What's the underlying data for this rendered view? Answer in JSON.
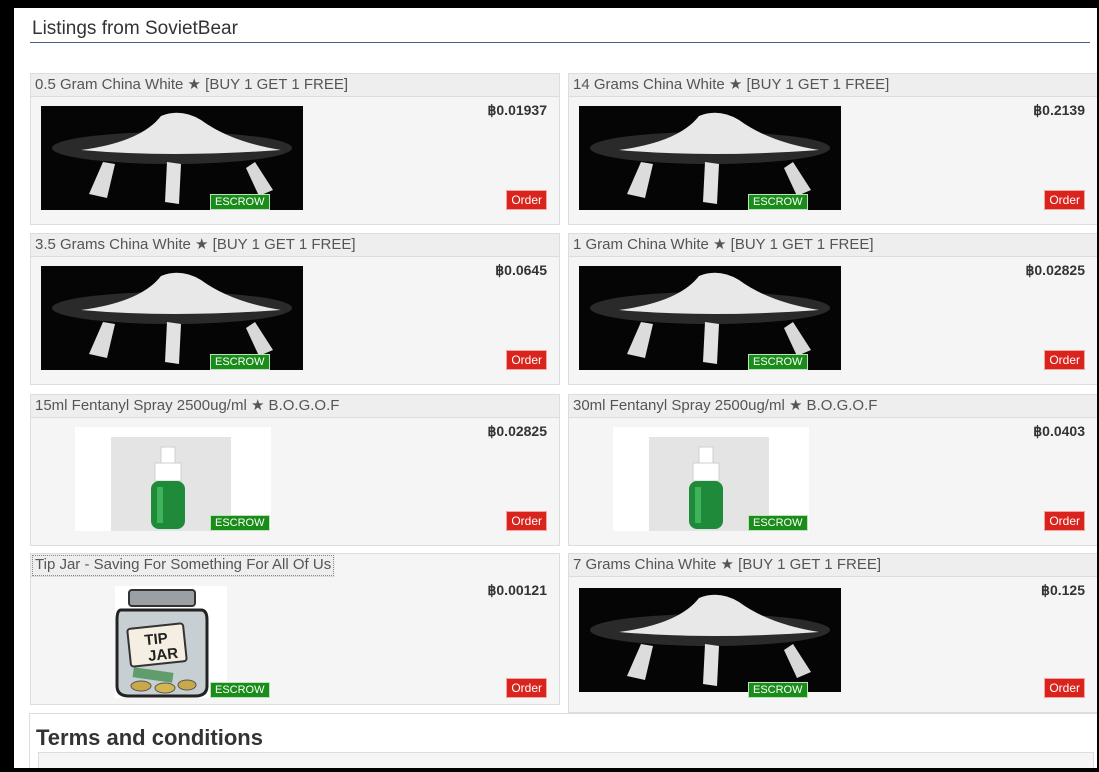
{
  "page": {
    "heading": "Listings from SovietBear"
  },
  "listings": [
    {
      "title": "0.5 Gram China White ★ [BUY 1 GET 1 FREE]",
      "price": "฿0.01937",
      "image": "powder-photo",
      "escrow": "ESCROW",
      "order": "Order"
    },
    {
      "title": "14 Grams China White ★ [BUY 1 GET 1 FREE]",
      "price": "฿0.2139",
      "image": "powder-photo",
      "escrow": "ESCROW",
      "order": "Order"
    },
    {
      "title": "3.5 Grams China White ★ [BUY 1 GET 1 FREE]",
      "price": "฿0.0645",
      "image": "powder-photo",
      "escrow": "ESCROW",
      "order": "Order"
    },
    {
      "title": "1 Gram China White ★ [BUY 1 GET 1 FREE]",
      "price": "฿0.02825",
      "image": "powder-photo",
      "escrow": "ESCROW",
      "order": "Order"
    },
    {
      "title": "15ml Fentanyl Spray 2500ug/ml ★ B.O.G.O.F",
      "price": "฿0.02825",
      "image": "spray-bottle-photo",
      "escrow": "ESCROW",
      "order": "Order"
    },
    {
      "title": "30ml Fentanyl Spray 2500ug/ml ★ B.O.G.O.F",
      "price": "฿0.0403",
      "image": "spray-bottle-photo",
      "escrow": "ESCROW",
      "order": "Order"
    },
    {
      "title": "Tip Jar - Saving For Something For All Of Us",
      "price": "฿0.00121",
      "image": "tip-jar-illustration",
      "escrow": "ESCROW",
      "order": "Order",
      "jar_label": [
        "TIP",
        "JAR"
      ]
    },
    {
      "title": "7 Grams China White ★ [BUY 1 GET 1 FREE]",
      "price": "฿0.125",
      "image": "powder-photo",
      "escrow": "ESCROW",
      "order": "Order"
    }
  ],
  "terms": {
    "heading": "Terms and conditions"
  },
  "colors": {
    "escrow_green": "#1a8c1a",
    "order_red": "#d9231d",
    "heading_rule": "#4a5f80"
  }
}
